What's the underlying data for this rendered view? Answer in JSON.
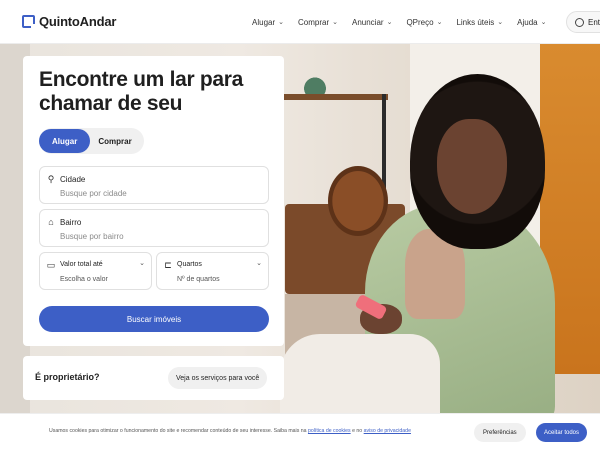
{
  "header": {
    "brand": "QuintoAndar",
    "nav": [
      {
        "label": "Alugar"
      },
      {
        "label": "Comprar"
      },
      {
        "label": "Anunciar"
      },
      {
        "label": "QPreço"
      },
      {
        "label": "Links úteis"
      },
      {
        "label": "Ajuda"
      }
    ],
    "login_label": "Entrar"
  },
  "hero": {
    "title": "Encontre um lar para chamar de seu",
    "toggle": {
      "rent": "Alugar",
      "buy": "Comprar",
      "selected": "Alugar"
    },
    "city": {
      "label": "Cidade",
      "placeholder": "Busque por cidade",
      "icon": "location-pin-icon"
    },
    "neighborhood": {
      "label": "Bairro",
      "placeholder": "Busque por bairro",
      "icon": "house-icon"
    },
    "total_value": {
      "label": "Valor total até",
      "value": "Escolha o valor",
      "icon": "money-icon"
    },
    "rooms": {
      "label": "Quartos",
      "value": "Nº de quartos",
      "icon": "bed-icon"
    },
    "search_button": "Buscar imóveis"
  },
  "owner": {
    "question": "É proprietário?",
    "button": "Veja os serviços para você"
  },
  "cookie": {
    "text_before": "Usamos cookies para otimizar o funcionamento do site e recomendar conteúdo de seu interesse. Saiba mais na",
    "policy_link": "política de cookies",
    "text_middle": "e no",
    "privacy_link": "aviso de privacidade",
    "preferences_button": "Preferências",
    "accept_button": "Aceitar todos"
  },
  "colors": {
    "brand_blue": "#3d5fc6",
    "accent_orange": "#d98b2f"
  }
}
